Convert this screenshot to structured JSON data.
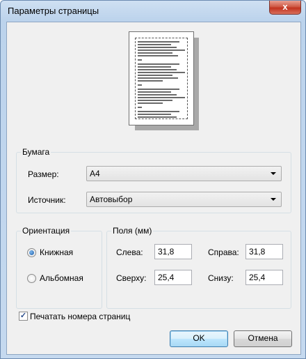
{
  "window": {
    "title": "Параметры страницы",
    "close_symbol": "x"
  },
  "paper": {
    "group_title": "Бумага",
    "size_label": "Размер:",
    "size_value": "А4",
    "source_label": "Источник:",
    "source_value": "Автовыбор"
  },
  "orientation": {
    "group_title": "Ориентация",
    "portrait_label": "Книжная",
    "landscape_label": "Альбомная",
    "selected": "portrait"
  },
  "margins": {
    "group_title": "Поля (мм)",
    "left_label": "Слева:",
    "left_value": "31,8",
    "right_label": "Справа:",
    "right_value": "31,8",
    "top_label": "Сверху:",
    "top_value": "25,4",
    "bottom_label": "Снизу:",
    "bottom_value": "25,4"
  },
  "print_page_numbers": {
    "label": "Печатать номера страниц",
    "checked": true,
    "check_symbol": "✓"
  },
  "buttons": {
    "ok": "OK",
    "cancel": "Отмена"
  }
}
